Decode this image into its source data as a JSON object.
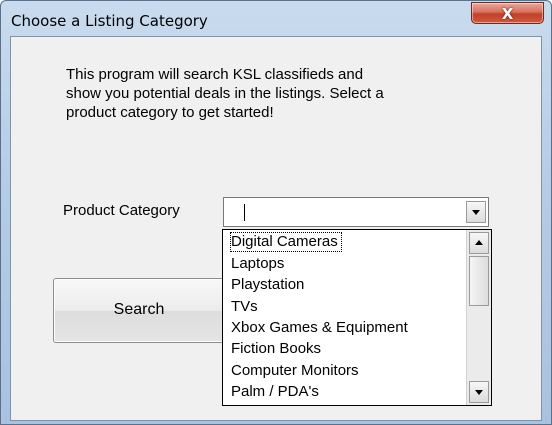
{
  "window": {
    "title": "Choose a Listing Category",
    "close_glyph": "X"
  },
  "description": {
    "line1": "This program will search KSL classifieds and",
    "line2": "show you potential deals in the listings. Select a",
    "line3": "product category to get started!"
  },
  "form": {
    "category_label": "Product Category",
    "category_value": ""
  },
  "search_button": {
    "label": "Search"
  },
  "dropdown": {
    "options": [
      "Digital Cameras",
      "Laptops",
      "Playstation",
      "TVs",
      "Xbox Games & Equipment",
      "Fiction Books",
      "Computer Monitors",
      "Palm / PDA's"
    ],
    "focused_index": 0
  },
  "icons": {
    "close": "close-icon",
    "dropdown": "chevron-down-icon",
    "scroll_up": "scroll-up-arrow-icon",
    "scroll_down": "scroll-down-arrow-icon"
  },
  "colors": {
    "titlebar": "#b7cde6",
    "close_button": "#c0412a",
    "client_background": "#f0f0f0"
  }
}
